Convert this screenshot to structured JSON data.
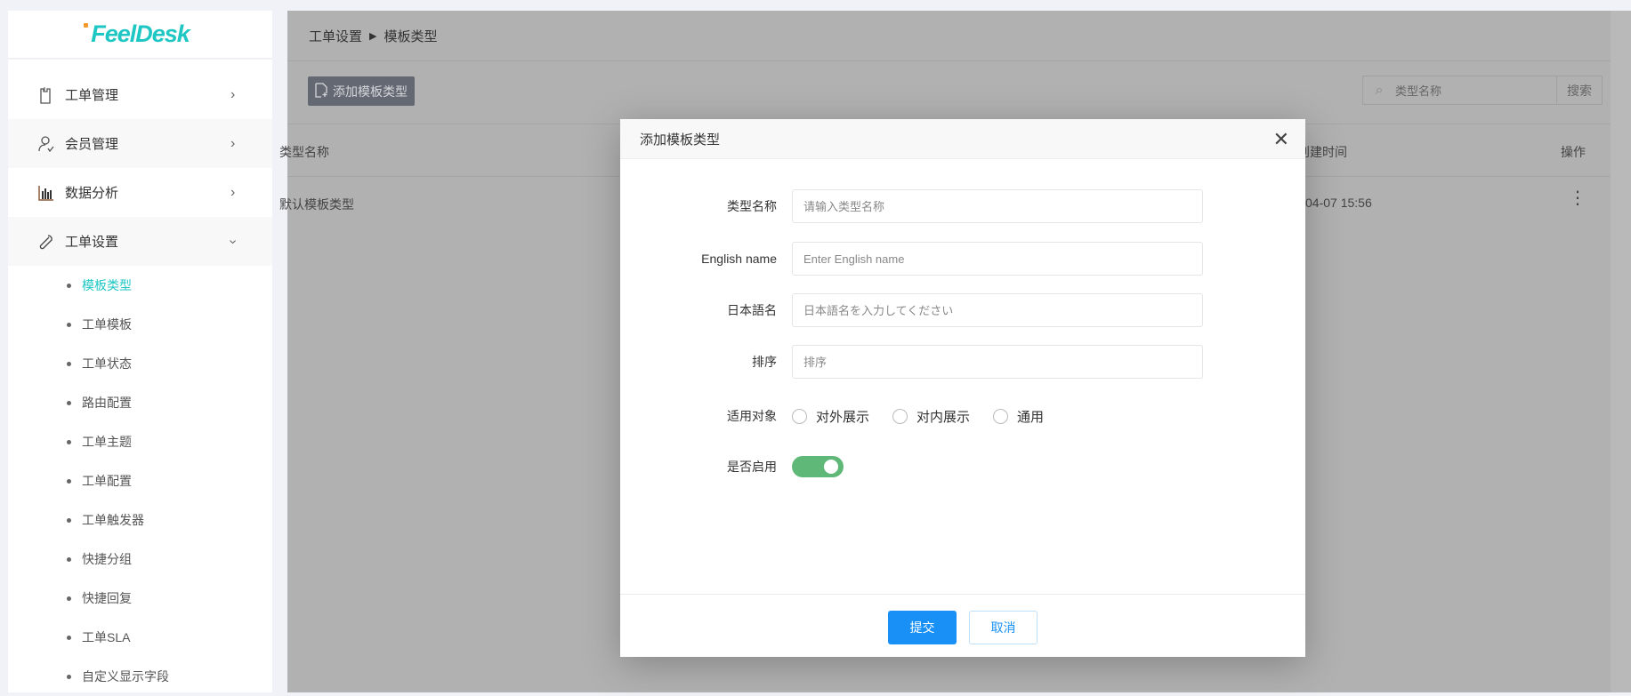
{
  "logo": "FeelDesk",
  "sidebar": {
    "items": [
      {
        "label": "工单管理",
        "icon": "clipboard-icon",
        "expanded": false
      },
      {
        "label": "会员管理",
        "icon": "users-icon",
        "expanded": false
      },
      {
        "label": "数据分析",
        "icon": "bar-chart-icon",
        "expanded": false
      },
      {
        "label": "工单设置",
        "icon": "wrench-icon",
        "expanded": true
      }
    ],
    "subitems": [
      "模板类型",
      "工单模板",
      "工单状态",
      "路由配置",
      "工单主题",
      "工单配置",
      "工单触发器",
      "快捷分组",
      "快捷回复",
      "工单SLA",
      "自定义显示字段"
    ],
    "active_subitem": "模板类型"
  },
  "breadcrumb": {
    "parent": "工单设置",
    "current": "模板类型"
  },
  "toolbar": {
    "add_label": "添加模板类型",
    "search_placeholder": "类型名称",
    "search_button": "搜索"
  },
  "table": {
    "headers": {
      "name": "类型名称",
      "created": "创建时间",
      "actions": "操作"
    },
    "rows": [
      {
        "name": "默认模板类型",
        "created": "04-07 15:56"
      }
    ]
  },
  "modal": {
    "title": "添加模板类型",
    "fields": [
      {
        "label": "类型名称",
        "placeholder": "请输入类型名称",
        "value": ""
      },
      {
        "label": "English name",
        "placeholder": "Enter English name",
        "value": ""
      },
      {
        "label": "日本語名",
        "placeholder": "日本語名を入力してください",
        "value": ""
      },
      {
        "label": "排序",
        "placeholder": "排序",
        "value": ""
      }
    ],
    "audience": {
      "label": "适用对象",
      "options": [
        "对外展示",
        "对内展示",
        "通用"
      ],
      "selected": null
    },
    "enabled": {
      "label": "是否启用",
      "value": true
    },
    "submit": "提交",
    "cancel": "取消"
  },
  "colors": {
    "brand": "#1ec7c4",
    "primary": "#1890f5",
    "toggle_on": "#5fb877"
  }
}
